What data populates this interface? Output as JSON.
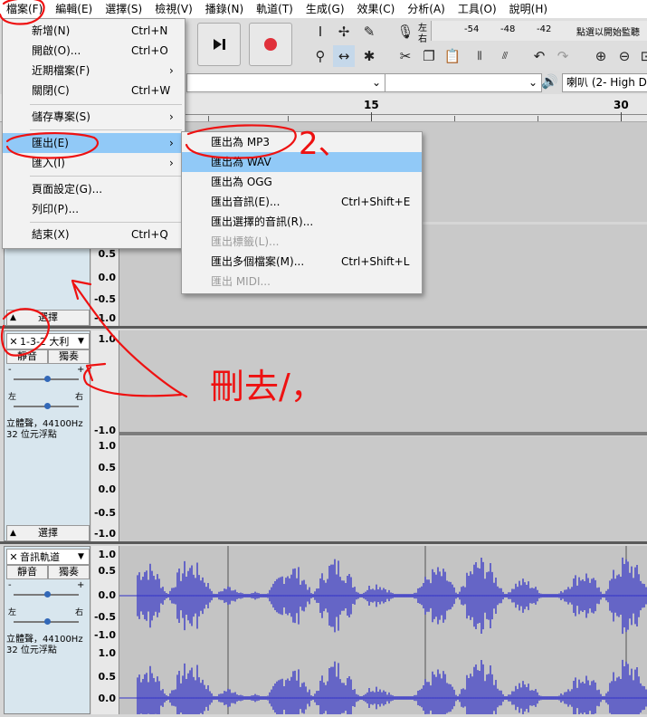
{
  "menubar": {
    "items": [
      "檔案(F)",
      "編輯(E)",
      "選擇(S)",
      "檢視(V)",
      "播錄(N)",
      "軌道(T)",
      "生成(G)",
      "效果(C)",
      "分析(A)",
      "工具(O)",
      "說明(H)"
    ]
  },
  "meter": {
    "lr_top": "左",
    "lr_bottom": "右",
    "ticks": [
      "-54",
      "-48",
      "-42"
    ],
    "hint": "點選以開始監聽"
  },
  "devices": {
    "output": "喇叭 (2- High De"
  },
  "timeline": {
    "ticks": [
      "15",
      "30"
    ]
  },
  "file_menu": {
    "items": [
      {
        "label": "新增(N)",
        "shortcut": "Ctrl+N"
      },
      {
        "label": "開啟(O)...",
        "shortcut": "Ctrl+O"
      },
      {
        "label": "近期檔案(F)",
        "shortcut": ""
      },
      {
        "label": "關閉(C)",
        "shortcut": "Ctrl+W"
      },
      {
        "label": "儲存專案(S)",
        "shortcut": ""
      },
      {
        "label": "匯出(E)",
        "shortcut": ""
      },
      {
        "label": "匯入(I)",
        "shortcut": ""
      },
      {
        "label": "頁面設定(G)...",
        "shortcut": ""
      },
      {
        "label": "列印(P)...",
        "shortcut": ""
      },
      {
        "label": "結束(X)",
        "shortcut": "Ctrl+Q"
      }
    ]
  },
  "export_menu": {
    "items": [
      {
        "label": "匯出為 MP3",
        "shortcut": ""
      },
      {
        "label": "匯出為 WAV",
        "shortcut": ""
      },
      {
        "label": "匯出為 OGG",
        "shortcut": ""
      },
      {
        "label": "匯出音訊(E)...",
        "shortcut": "Ctrl+Shift+E"
      },
      {
        "label": "匯出選擇的音訊(R)...",
        "shortcut": ""
      },
      {
        "label": "匯出標籤(L)...",
        "shortcut": ""
      },
      {
        "label": "匯出多個檔案(M)...",
        "shortcut": "Ctrl+Shift+L"
      },
      {
        "label": "匯出 MIDI...",
        "shortcut": ""
      }
    ]
  },
  "tracks": {
    "track1": {
      "select": "選擇"
    },
    "track2": {
      "name": "1-3-2 大利",
      "mute": "靜音",
      "solo": "獨奏",
      "pan_left": "左",
      "pan_right": "右",
      "info1": "立體聲，44100Hz",
      "info2": "32 位元浮點",
      "select": "選擇"
    },
    "track3": {
      "name": "音訊軌道",
      "mute": "靜音",
      "solo": "獨奏",
      "pan_left": "左",
      "pan_right": "右",
      "info1": "立體聲，44100Hz",
      "info2": "32 位元浮點"
    }
  },
  "scale": {
    "full": [
      "0.5",
      "0.0",
      "-0.5",
      "-1.0"
    ],
    "labels": [
      "1.0",
      "0.5",
      "0.0",
      "-0.5",
      "-1.0"
    ]
  },
  "annotation": {
    "note": "刪去/，",
    "step2": "2、"
  },
  "colors": {
    "waveform": "#3232c8",
    "highlight": "#91c9f7",
    "annotation": "#ee1111",
    "record": "#e0303a"
  }
}
